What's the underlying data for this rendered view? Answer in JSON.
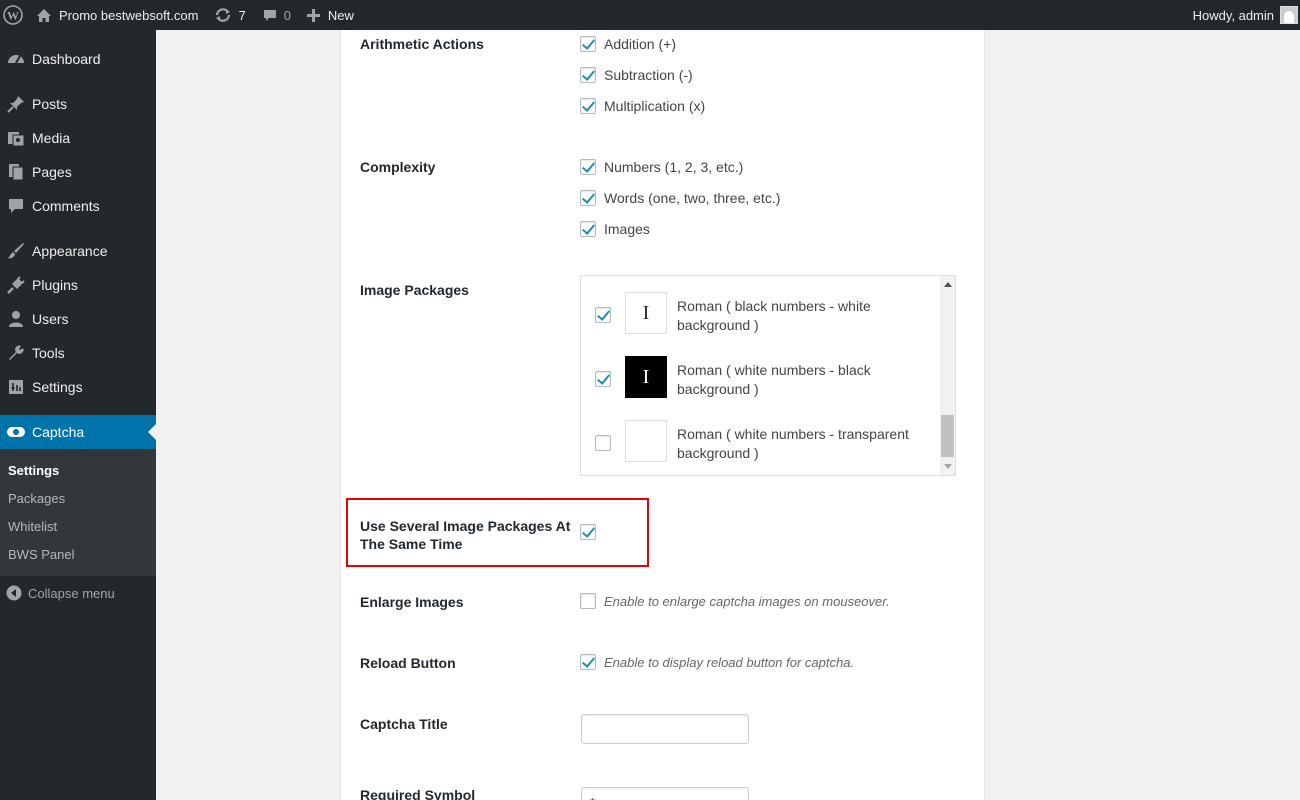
{
  "adminbar": {
    "site_name": "Promo bestwebsoft.com",
    "updates_count": "7",
    "comments_count": "0",
    "new_label": "New",
    "greeting": "Howdy, admin"
  },
  "sidebar": {
    "items": [
      {
        "label": "Dashboard",
        "icon": "dashboard-icon"
      },
      {
        "label": "Posts",
        "icon": "pushpin-icon"
      },
      {
        "label": "Media",
        "icon": "media-icon"
      },
      {
        "label": "Pages",
        "icon": "pages-icon"
      },
      {
        "label": "Comments",
        "icon": "comment-icon"
      },
      {
        "label": "Appearance",
        "icon": "paintbrush-icon"
      },
      {
        "label": "Plugins",
        "icon": "plug-icon"
      },
      {
        "label": "Users",
        "icon": "user-icon"
      },
      {
        "label": "Tools",
        "icon": "wrench-icon"
      },
      {
        "label": "Settings",
        "icon": "settings-icon"
      },
      {
        "label": "Captcha",
        "icon": "eye-icon"
      }
    ],
    "submenu": [
      "Settings",
      "Packages",
      "Whitelist",
      "BWS Panel"
    ],
    "collapse_label": "Collapse menu"
  },
  "settings": {
    "arithmetic": {
      "label": "Arithmetic Actions",
      "options": [
        {
          "text": "Addition (+)",
          "checked": true
        },
        {
          "text": "Subtraction (-)",
          "checked": true
        },
        {
          "text": "Multiplication (x)",
          "checked": true
        }
      ]
    },
    "complexity": {
      "label": "Complexity",
      "options": [
        {
          "text": "Numbers (1, 2, 3, etc.)",
          "checked": true
        },
        {
          "text": "Words (one, two, three, etc.)",
          "checked": true
        },
        {
          "text": "Images",
          "checked": true
        }
      ]
    },
    "image_packages": {
      "label": "Image Packages",
      "packages": [
        {
          "thumb": "I",
          "line1": "Roman ( black numbers - white",
          "line2": "background )",
          "checked": true
        },
        {
          "thumb": "I",
          "line1": "Roman ( white numbers - black",
          "line2": "background )",
          "checked": true
        },
        {
          "thumb": "",
          "line1": "Roman ( white numbers - transparent",
          "line2": "background )",
          "checked": false
        }
      ]
    },
    "several_packages": {
      "label_line1": "Use Several Image Packages At",
      "label_line2": "The Same Time",
      "checked": true
    },
    "enlarge": {
      "label": "Enlarge Images",
      "desc": "Enable to enlarge captcha images on mouseover.",
      "checked": false
    },
    "reload": {
      "label": "Reload Button",
      "desc": "Enable to display reload button for captcha.",
      "checked": true
    },
    "title": {
      "label": "Captcha Title",
      "value": ""
    },
    "required": {
      "label": "Required Symbol",
      "value": "*"
    }
  }
}
